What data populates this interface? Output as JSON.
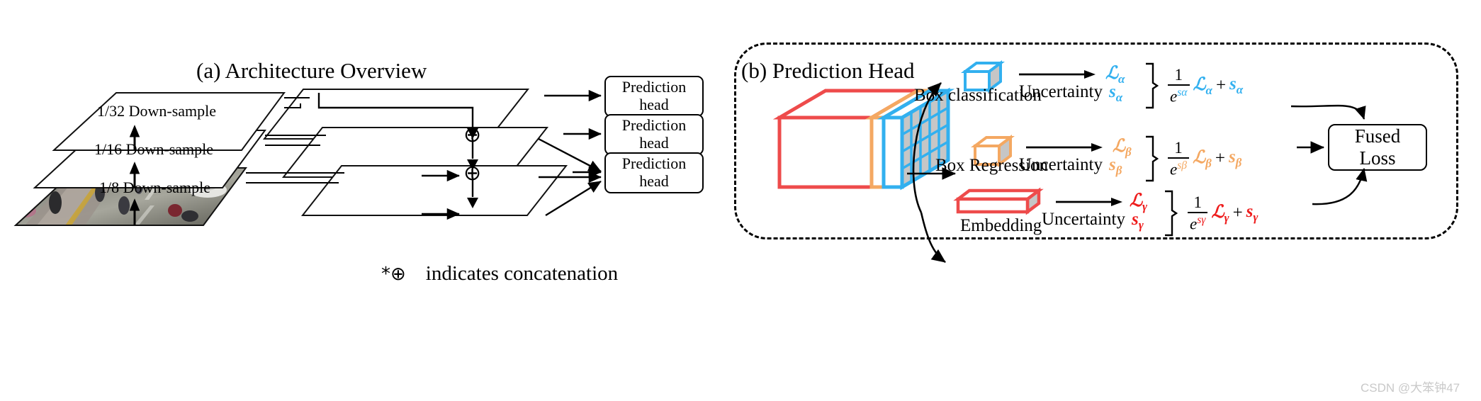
{
  "panel_a": {
    "title": "(a) Architecture Overview",
    "layers": [
      {
        "label": "1/32 Down-sample"
      },
      {
        "label": "1/16 Down-sample"
      },
      {
        "label": "1/8 Down-sample"
      }
    ],
    "prediction_heads": [
      {
        "line1": "Prediction",
        "line2": "head"
      },
      {
        "line1": "Prediction",
        "line2": "head"
      },
      {
        "line1": "Prediction",
        "line2": "head"
      }
    ],
    "legend": {
      "symbol": "*⊕",
      "text": "indicates concatenation"
    },
    "concat_symbol": "⊕",
    "input_image_alt": "traffic-scene-frame"
  },
  "panel_b": {
    "title": "(b) Prediction Head",
    "feature_cube": {
      "slab_colors": [
        "#ee4b4b",
        "#f4a862",
        "#32b0ef"
      ],
      "grid_face_color": "#c6c6c6"
    },
    "branches": [
      {
        "name": "box-classification",
        "label": "Box classification",
        "icon": "cube-icon",
        "color": "#32b0ef",
        "loss_symbol": "ℒ",
        "loss_sub": "α",
        "uncertainty_label": "Uncertainty",
        "uncertainty_symbol": "s",
        "uncertainty_sub": "α",
        "formula_num": "1",
        "formula_den_base": "e",
        "formula_den_exp": "sα",
        "formula_tail_plus": "+"
      },
      {
        "name": "box-regression",
        "label": "Box Regression",
        "icon": "cube-icon",
        "color": "#f4a862",
        "loss_symbol": "ℒ",
        "loss_sub": "β",
        "uncertainty_label": "Uncertainty",
        "uncertainty_symbol": "s",
        "uncertainty_sub": "β",
        "formula_num": "1",
        "formula_den_base": "e",
        "formula_den_exp": "sβ",
        "formula_tail_plus": "+"
      },
      {
        "name": "embedding",
        "label": "Embedding",
        "icon": "flat-box-icon",
        "color": "#ee4b4b",
        "loss_symbol": "ℒ",
        "loss_sub": "γ",
        "uncertainty_label": "Uncertainty",
        "uncertainty_symbol": "s",
        "uncertainty_sub": "γ",
        "formula_num": "1",
        "formula_den_base": "e",
        "formula_den_exp": "sγ",
        "formula_tail_plus": "+"
      }
    ],
    "fused_loss": {
      "line1": "Fused",
      "line2": "Loss"
    }
  },
  "watermark": "CSDN @大笨钟47",
  "colors": {
    "blue": "#32b0ef",
    "orange": "#f4a862",
    "red": "#ee4b4b",
    "black": "#000000",
    "grid_gray": "#c6c6c6"
  }
}
